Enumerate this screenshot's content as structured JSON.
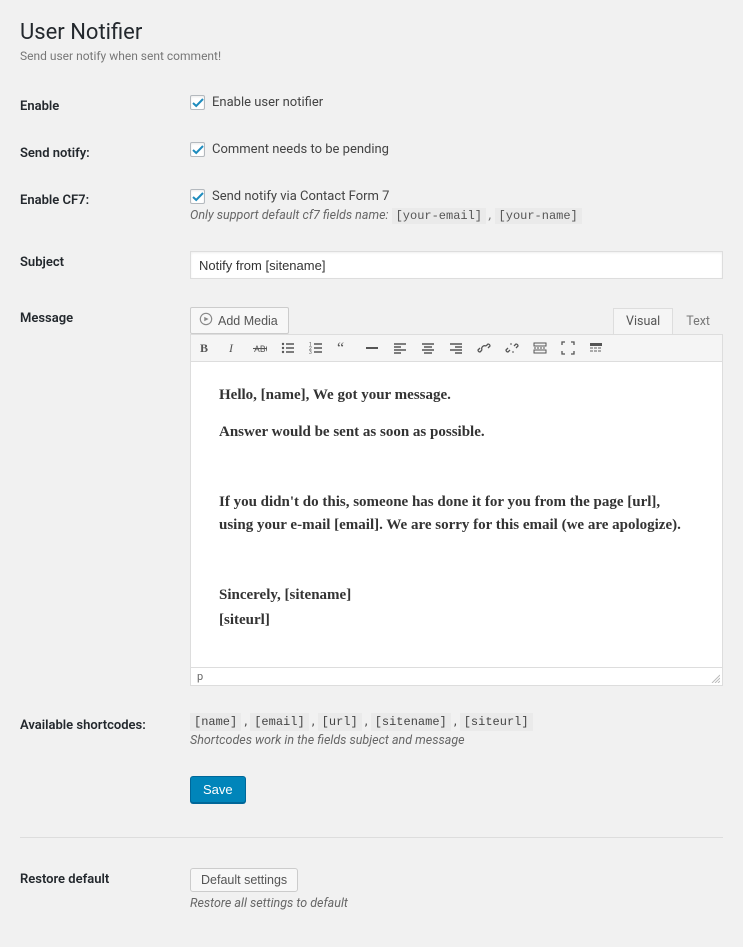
{
  "header": {
    "title": "User Notifier",
    "description": "Send user notify when sent comment!"
  },
  "rows": {
    "enable": {
      "label": "Enable",
      "checkbox_label": "Enable user notifier",
      "checked": true
    },
    "send_notify": {
      "label": "Send notify:",
      "checkbox_label": "Comment needs to be pending",
      "checked": true
    },
    "enable_cf7": {
      "label": "Enable CF7:",
      "checkbox_label": "Send notify via Contact Form 7",
      "checked": true,
      "hint_prefix": "Only support default cf7 fields name: ",
      "hint_code1": "[your-email]",
      "hint_sep": " , ",
      "hint_code2": "[your-name]"
    },
    "subject": {
      "label": "Subject",
      "value": "Notify from [sitename]"
    },
    "message": {
      "label": "Message",
      "add_media": "Add Media",
      "tab_visual": "Visual",
      "tab_text": "Text",
      "content_line1": "Hello, [name], We got your message.",
      "content_line2": "Answer would be sent as soon as possible.",
      "content_line3": "If you didn't do this, someone has done it for you from the page [url], using your e-mail [email]. We are sorry for this email (we are apologize).",
      "content_line4": "Sincerely, [sitename]",
      "content_line5": "[siteurl]",
      "status_path": "p"
    },
    "shortcodes": {
      "label": "Available shortcodes:",
      "code1": "[name]",
      "code2": "[email]",
      "code3": "[url]",
      "code4": "[sitename]",
      "code5": "[siteurl]",
      "sep": " , ",
      "hint": "Shortcodes work in the fields subject and message"
    },
    "save": "Save",
    "restore": {
      "label": "Restore default",
      "button": "Default settings",
      "hint": "Restore all settings to default"
    }
  },
  "toolbar_icons": [
    "bold-icon",
    "italic-icon",
    "strikethrough-icon",
    "bullet-list-icon",
    "number-list-icon",
    "blockquote-icon",
    "hr-icon",
    "align-left-icon",
    "align-center-icon",
    "align-right-icon",
    "link-icon",
    "unlink-icon",
    "readmore-icon",
    "fullscreen-icon",
    "toolbar-toggle-icon"
  ]
}
